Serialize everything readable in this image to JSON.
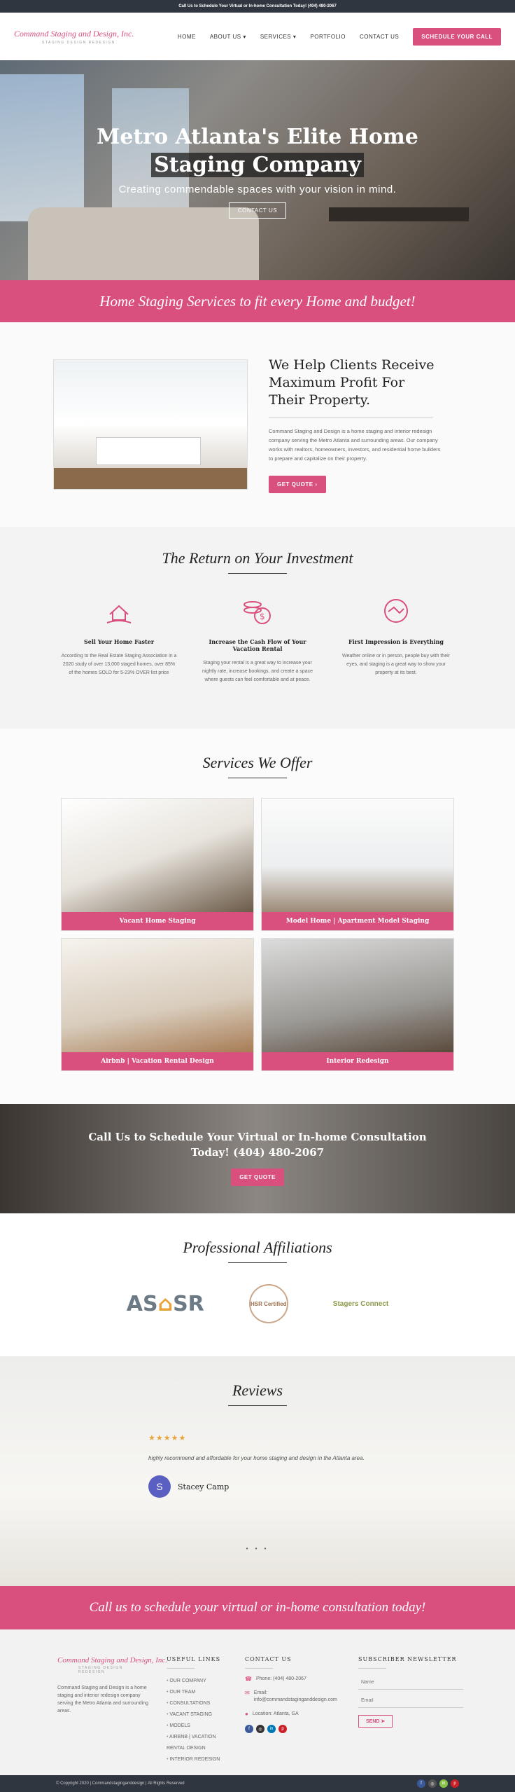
{
  "topbar": {
    "text": "Call Us to Schedule Your Virtual or In-home Consultation Today! (404) 480-2067"
  },
  "header": {
    "logo_text": "Command Staging and Design, Inc.",
    "logo_sub": "STAGING  DESIGN  REDESIGN",
    "nav": [
      "HOME",
      "ABOUT US",
      "SERVICES",
      "PORTFOLIO",
      "CONTACT US"
    ],
    "cta": "SCHEDULE YOUR CALL"
  },
  "hero": {
    "title_line1": "Metro Atlanta's Elite Home",
    "title_line2": "Staging Company",
    "subtitle": "Creating commendable spaces with your vision in mind.",
    "button": "CONTACT US"
  },
  "band1": {
    "text": "Home Staging Services to fit every Home and budget!"
  },
  "intro": {
    "heading": "We Help Clients Receive Maximum Profit For Their Property.",
    "body": "Command Staging and Design is a home staging and interior redesign company serving the Metro Atlanta and surrounding areas. Our company works with realtors, homeowners, investors, and residential home builders to prepare and capitalize on their property.",
    "button": "GET QUOTE"
  },
  "roi": {
    "title": "The Return on Your Investment",
    "items": [
      {
        "icon": "house-hand-icon",
        "title": "Sell Your Home Faster",
        "body": "According to the Real Estate Staging Association in a 2020 study of over 13,000 staged homes, over 85% of the homes SOLD for 5-23% OVER list price"
      },
      {
        "icon": "money-coins-icon",
        "title": "Increase the Cash Flow of Your Vacation Rental",
        "body": "Staging your rental is a great way to increase your nightly rate, increase bookings, and create a space where guests can feel comfortable and at peace."
      },
      {
        "icon": "handshake-icon",
        "title": "First Impression is Everything",
        "body": "Weather online or in person, people buy with their eyes, and staging is a great way to show your property at its best."
      }
    ]
  },
  "services": {
    "title": "Services We Offer",
    "items": [
      "Vacant Home Staging",
      "Model Home | Apartment Model Staging",
      "Airbnb | Vacation Rental Design",
      "Interior Redesign"
    ]
  },
  "cta": {
    "line1": "Call Us to Schedule Your Virtual or In-home Consultation",
    "line2": "Today! (404) 480-2067",
    "button": "GET QUOTE"
  },
  "affiliations": {
    "title": "Professional Affiliations",
    "logo1_a": "AS",
    "logo1_b": "SR",
    "logo2": "HSR Certified",
    "logo3": "Stagers Connect"
  },
  "reviews": {
    "title": "Reviews",
    "stars": "★★★★★",
    "text": "highly recommend and affordable for your home staging and design in the Atlanta area.",
    "avatar_letter": "S",
    "name": "Stacey Camp",
    "dots": "• • •"
  },
  "band2": {
    "text": "Call us to schedule your virtual or in-home consultation today!"
  },
  "footer": {
    "about_logo": "Command Staging and Design, Inc.",
    "about_sub": "STAGING  DESIGN  REDESIGN",
    "about_text": "Command Staging and Design is a home staging and interior redesign company serving the Metro Atlanta and surrounding areas.",
    "links_title": "USEFUL LINKS",
    "links": [
      "OUR COMPANY",
      "OUR TEAM",
      "CONSULTATIONS",
      "VACANT STAGING",
      "MODELS",
      "AIRBNB | VACATION RENTAL DESIGN",
      "INTERIOR REDESIGN"
    ],
    "contact_title": "CONTACT US",
    "phone": "Phone: (404) 480-2067",
    "email_label": "Email:",
    "email": "info@commandstaginganddesign.com",
    "location": "Location: Atlanta, GA",
    "news_title": "SUBSCRIBER NEWSLETTER",
    "name_placeholder": "Name",
    "email_placeholder": "Email",
    "send": "SEND"
  },
  "bottom": {
    "copyright": "© Copyright 2020 | Commandstaginganddesign | All Rights Reserved"
  },
  "colors": {
    "accent": "#d94f7e",
    "dark": "#2f3640"
  }
}
